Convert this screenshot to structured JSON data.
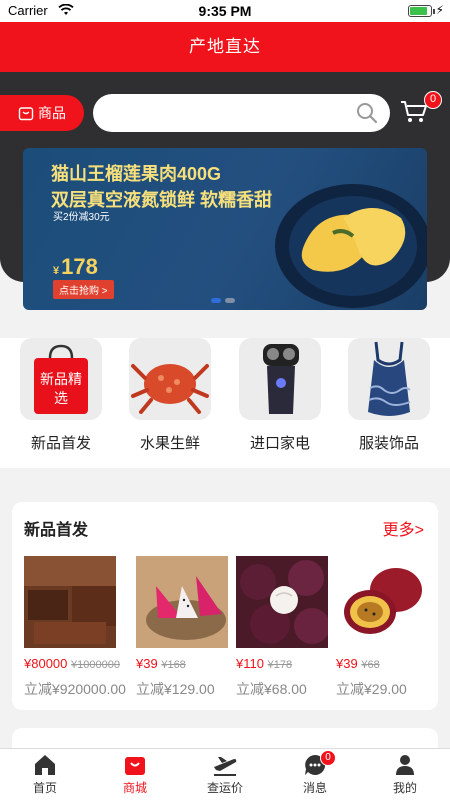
{
  "status": {
    "carrier": "Carrier",
    "time": "9:35 PM",
    "battery_level": 0.85
  },
  "header": {
    "title": "产地直达"
  },
  "search": {
    "category_label": "商品",
    "placeholder": "",
    "cart_count": "0"
  },
  "banner": {
    "line1": "猫山王榴莲果肉400G",
    "line2": "双层真空液氮锁鲜 软糯香甜",
    "line3": "买2份减30元",
    "price_symbol": "¥",
    "price": "178",
    "cta": "点击抢购 >",
    "active_dot": 0
  },
  "categories": [
    {
      "label": "新品首发",
      "tile_text": "新品精选",
      "icon": "new-product-bag-icon"
    },
    {
      "label": "水果生鲜",
      "icon": "crab-icon"
    },
    {
      "label": "进口家电",
      "icon": "shaver-icon"
    },
    {
      "label": "服装饰品",
      "icon": "swimsuit-icon"
    }
  ],
  "section": {
    "title": "新品首发",
    "more": "更多>",
    "products": [
      {
        "price": "¥80000",
        "orig": "¥1000000",
        "discount": "立减¥920000.00",
        "image": "wooden-furniture"
      },
      {
        "price": "¥39",
        "orig": "¥168",
        "discount": "立减¥129.00",
        "image": "dragon-fruit"
      },
      {
        "price": "¥110",
        "orig": "¥178",
        "discount": "立减¥68.00",
        "image": "mangosteen"
      },
      {
        "price": "¥39",
        "orig": "¥68",
        "discount": "立减¥29.00",
        "image": "passion-fruit"
      }
    ]
  },
  "tabs": [
    {
      "label": "首页",
      "icon": "home-icon",
      "active": false
    },
    {
      "label": "商城",
      "icon": "shop-bag-icon",
      "active": true
    },
    {
      "label": "查运价",
      "icon": "plane-icon",
      "active": false
    },
    {
      "label": "消息",
      "icon": "message-icon",
      "active": false,
      "badge": "0"
    },
    {
      "label": "我的",
      "icon": "profile-icon",
      "active": false
    }
  ],
  "colors": {
    "brand_red": "#f0131b",
    "dark": "#2f2f31"
  }
}
